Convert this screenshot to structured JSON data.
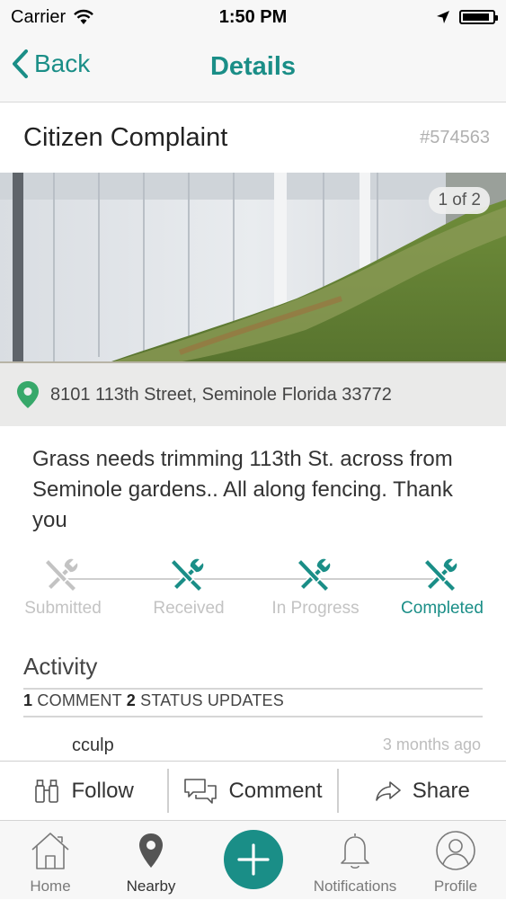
{
  "status_bar": {
    "carrier": "Carrier",
    "time": "1:50 PM",
    "battery_level": 0.9
  },
  "nav": {
    "back_label": "Back",
    "title": "Details"
  },
  "request": {
    "title": "Citizen Complaint",
    "id": "#574563",
    "photo_counter": "1 of 2",
    "address": "8101  113th Street, Seminole Florida 33772",
    "description": "Grass needs trimming 113th St. across from Seminole gardens.. All along fencing. Thank you"
  },
  "progress": {
    "steps": [
      {
        "label": "Submitted",
        "done": false
      },
      {
        "label": "Received",
        "done": true
      },
      {
        "label": "In Progress",
        "done": true
      },
      {
        "label": "Completed",
        "done": true
      }
    ]
  },
  "activity": {
    "title": "Activity",
    "comment_count": "1",
    "comment_label": "COMMENT",
    "status_count": "2",
    "status_label": "STATUS UPDATES",
    "first_comment": {
      "user": "cculp",
      "time": "3 months ago"
    }
  },
  "actions": {
    "follow": "Follow",
    "comment": "Comment",
    "share": "Share"
  },
  "tabs": {
    "home": "Home",
    "nearby": "Nearby",
    "notifications": "Notifications",
    "profile": "Profile"
  },
  "colors": {
    "accent": "#1a8e87",
    "inactive": "#c3c3c3"
  }
}
